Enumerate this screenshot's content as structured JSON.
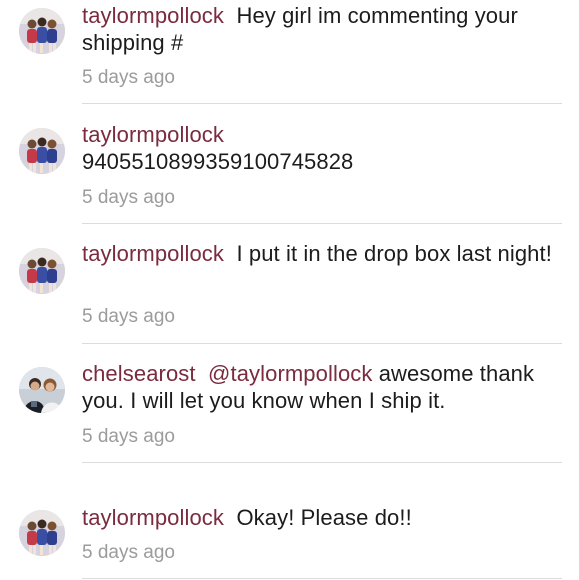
{
  "comments": [
    {
      "username": "taylormpollock",
      "mention": "",
      "text": "Hey girl im commenting your shipping #",
      "time": "5 days ago",
      "avatar": "group-photo-avatar"
    },
    {
      "username": "taylormpollock",
      "mention": "",
      "text": "9405510899359100745828",
      "time": "5 days ago",
      "avatar": "group-photo-avatar"
    },
    {
      "username": "taylormpollock",
      "mention": "",
      "text": "I put it in the drop box last night!",
      "time": "5 days ago",
      "avatar": "group-photo-avatar"
    },
    {
      "username": "chelsearost",
      "mention": "@taylormpollock",
      "text": "awesome thank you. I will let you know when I ship it.",
      "time": "5 days ago",
      "avatar": "couple-photo-avatar"
    },
    {
      "username": "taylormpollock",
      "mention": "",
      "text": "Okay! Please do!!",
      "time": "5 days ago",
      "avatar": "group-photo-avatar"
    }
  ],
  "colors": {
    "username": "#7a2b3d",
    "text": "#1c1c1c",
    "time": "#9b9b9b",
    "divider": "#dcdcdc"
  }
}
